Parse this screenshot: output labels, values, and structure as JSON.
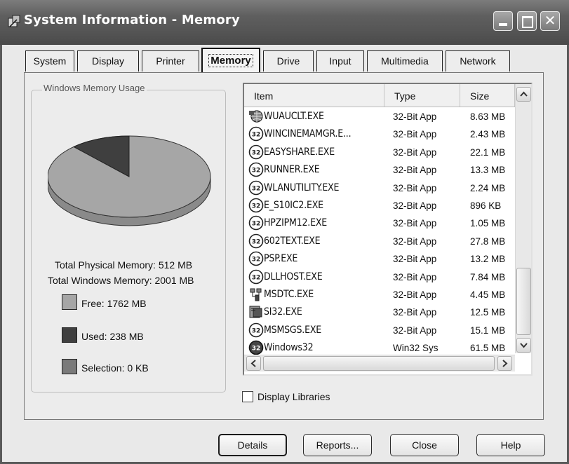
{
  "window": {
    "title": "System Information - Memory",
    "accent": "#5a5a5a"
  },
  "title_buttons": {
    "minimize_icon": "minimize-icon",
    "maximize_icon": "maximize-icon",
    "close_label": "✕"
  },
  "tabs": [
    {
      "label": "System",
      "active": false
    },
    {
      "label": "Display",
      "active": false
    },
    {
      "label": "Printer",
      "active": false
    },
    {
      "label": "Memory",
      "active": true
    },
    {
      "label": "Drive",
      "active": false
    },
    {
      "label": "Input",
      "active": false
    },
    {
      "label": "Multimedia",
      "active": false
    },
    {
      "label": "Network",
      "active": false
    }
  ],
  "memory_usage": {
    "group_label": "Windows Memory Usage",
    "total_physical": "Total Physical Memory: 512 MB",
    "total_windows": "Total Windows Memory: 2001 MB",
    "pie": {
      "free_fraction": 0.881,
      "used_fraction": 0.119,
      "selection_fraction": 0,
      "colors": {
        "free": "#a6a6a6",
        "used": "#3f3f3f",
        "selection": "#7a7a7a"
      }
    },
    "legend": [
      {
        "label": "Free: 1762 MB",
        "color": "#a6a6a6"
      },
      {
        "label": "Used: 238 MB",
        "color": "#3f3f3f"
      },
      {
        "label": "Selection: 0 KB",
        "color": "#7a7a7a"
      }
    ]
  },
  "process_list": {
    "columns": {
      "item": "Item",
      "type": "Type",
      "size": "Size"
    },
    "rows": [
      {
        "item": "WUAUCLT.EXE",
        "type": "32-Bit App",
        "size": "8.63 MB",
        "icon": "globe-icon"
      },
      {
        "item": "WINCINEMAMGR.E...",
        "type": "32-Bit App",
        "size": "2.43 MB",
        "icon": "app32-icon"
      },
      {
        "item": "EASYSHARE.EXE",
        "type": "32-Bit App",
        "size": "22.1 MB",
        "icon": "app32-icon"
      },
      {
        "item": "RUNNER.EXE",
        "type": "32-Bit App",
        "size": "13.3 MB",
        "icon": "app32-icon"
      },
      {
        "item": "WLANUTILITY.EXE",
        "type": "32-Bit App",
        "size": "2.24 MB",
        "icon": "app32-icon"
      },
      {
        "item": "E_S10IC2.EXE",
        "type": "32-Bit App",
        "size": "896 KB",
        "icon": "app32-icon"
      },
      {
        "item": "HPZIPM12.EXE",
        "type": "32-Bit App",
        "size": "1.05 MB",
        "icon": "app32-icon"
      },
      {
        "item": "602TEXT.EXE",
        "type": "32-Bit App",
        "size": "27.8 MB",
        "icon": "app32-icon"
      },
      {
        "item": "PSP.EXE",
        "type": "32-Bit App",
        "size": "13.2 MB",
        "icon": "app32-icon"
      },
      {
        "item": "DLLHOST.EXE",
        "type": "32-Bit App",
        "size": "7.84 MB",
        "icon": "app32-icon"
      },
      {
        "item": "MSDTC.EXE",
        "type": "32-Bit App",
        "size": "4.45 MB",
        "icon": "network-icon"
      },
      {
        "item": "SI32.EXE",
        "type": "32-Bit App",
        "size": "12.5 MB",
        "icon": "sysinfo-icon"
      },
      {
        "item": "MSMSGS.EXE",
        "type": "32-Bit App",
        "size": "15.1 MB",
        "icon": "app32-icon"
      },
      {
        "item": "Windows32",
        "type": "Win32 Sys",
        "size": "61.5 MB",
        "icon": "win32-icon"
      }
    ],
    "scroll": {
      "vertical_position": 0.78,
      "horizontal_position": 0.0
    }
  },
  "display_libraries": {
    "label": "Display Libraries",
    "checked": false
  },
  "buttons": {
    "details": "Details",
    "reports": "Reports...",
    "close": "Close",
    "help": "Help"
  }
}
